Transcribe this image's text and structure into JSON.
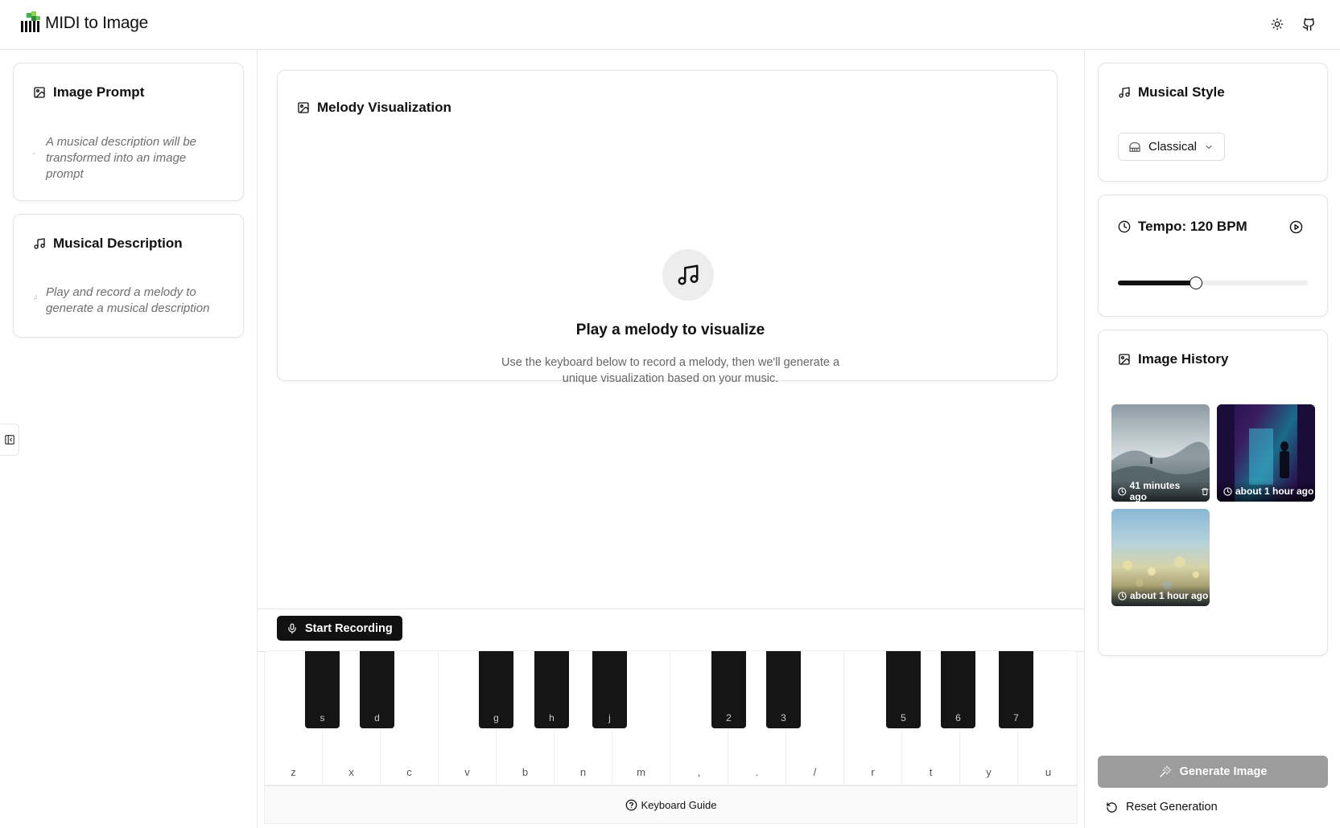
{
  "app": {
    "title": "MIDI to Image"
  },
  "header": {
    "theme_icon": "sun-icon",
    "github_icon": "github-icon"
  },
  "left_panel": {
    "image_prompt": {
      "title": "Image Prompt",
      "icon": "image-icon",
      "placeholder": "A musical description will be transformed into an image prompt"
    },
    "musical_description": {
      "title": "Musical Description",
      "icon": "music-note-icon",
      "placeholder": "Play and record a melody to generate a musical description"
    }
  },
  "center": {
    "visualization": {
      "title": "Melody Visualization",
      "icon": "image-icon",
      "empty_icon": "music-note-icon",
      "empty_title": "Play a melody to visualize",
      "empty_description": "Use the keyboard below to record a melody, then we'll generate a unique visualization based on your music."
    },
    "record_button": "Start Recording",
    "keyboard": {
      "white_keys": [
        "z",
        "x",
        "c",
        "v",
        "b",
        "n",
        "m",
        ",",
        ".",
        "/",
        "r",
        "t",
        "y",
        "u"
      ],
      "black_keys": [
        "s",
        "d",
        "g",
        "h",
        "j",
        "2",
        "3",
        "5",
        "6",
        "7"
      ]
    },
    "keyboard_guide": "Keyboard Guide"
  },
  "right_panel": {
    "musical_style": {
      "title": "Musical Style",
      "icon": "music-note-icon",
      "selected": "Classical",
      "selected_icon": "piano-icon"
    },
    "tempo": {
      "title": "Tempo: 120 BPM",
      "icon": "clock-icon",
      "play_icon": "play-circle-icon",
      "bpm": 120,
      "slider_fraction": 0.41
    },
    "image_history": {
      "title": "Image History",
      "icon": "image-icon",
      "items": [
        {
          "time": "41 minutes ago",
          "style": "misty mountains",
          "color": "#b8c3c8"
        },
        {
          "time": "about 1 hour ago",
          "style": "neon alley",
          "color": "#3a1c5e"
        },
        {
          "time": "about 1 hour ago",
          "style": "golden bokeh",
          "color": "#d5d3a8"
        }
      ]
    },
    "generate_button": "Generate Image",
    "reset_button": "Reset Generation"
  }
}
